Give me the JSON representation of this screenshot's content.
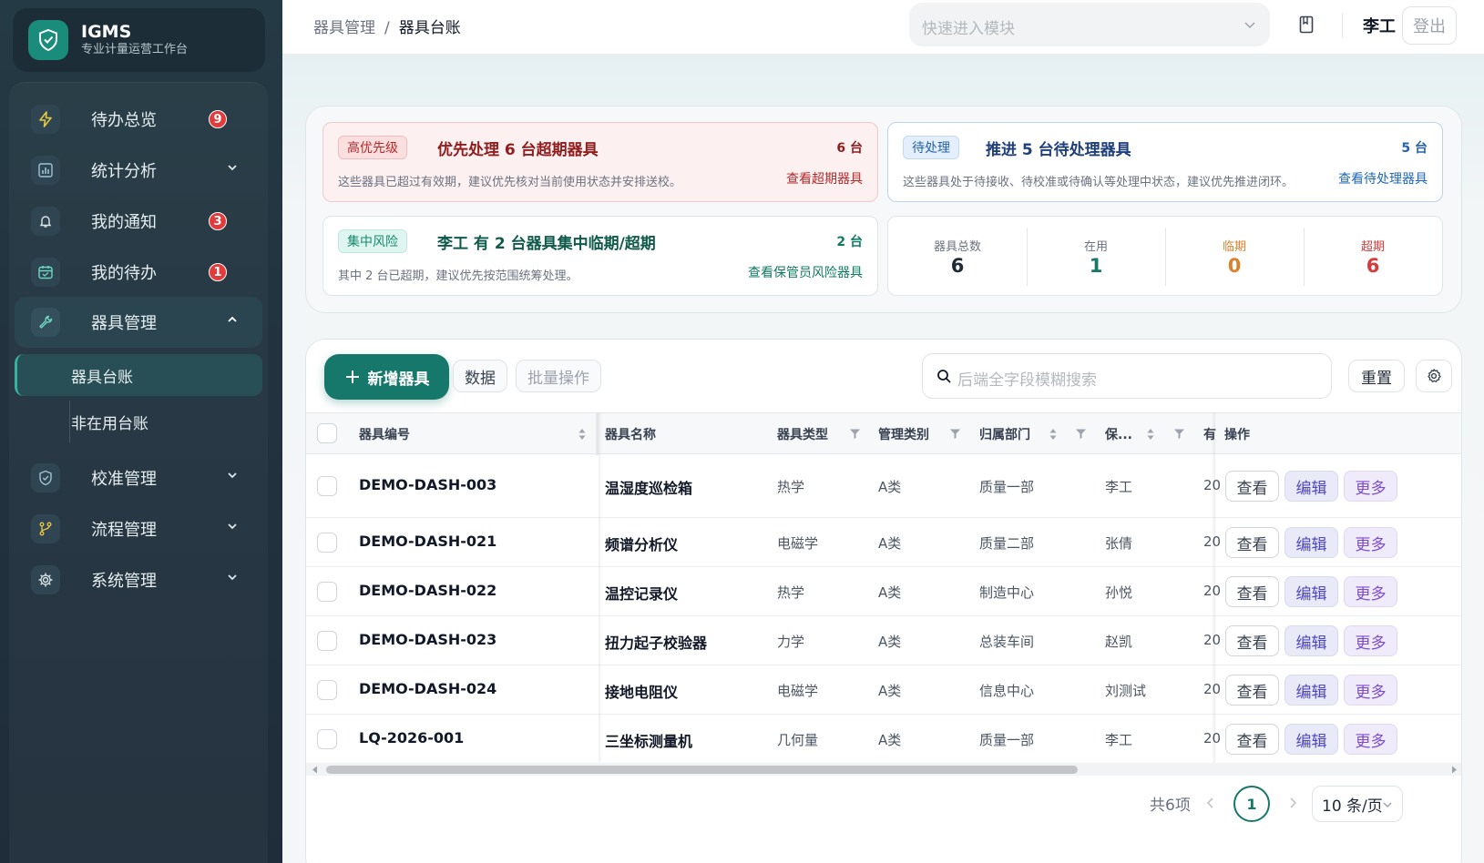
{
  "brand": {
    "name": "IGMS",
    "subtitle": "专业计量运营工作台"
  },
  "sidebar": {
    "items": [
      {
        "label": "待办总览",
        "badge": "9"
      },
      {
        "label": "统计分析"
      },
      {
        "label": "我的通知",
        "badge": "3"
      },
      {
        "label": "我的待办",
        "badge": "1"
      },
      {
        "label": "器具管理"
      },
      {
        "label": "校准管理"
      },
      {
        "label": "流程管理"
      },
      {
        "label": "系统管理"
      }
    ],
    "sub_items": [
      {
        "label": "器具台账"
      },
      {
        "label": "非在用台账"
      }
    ]
  },
  "header": {
    "breadcrumb": [
      "器具管理",
      "器具台账"
    ],
    "quick_placeholder": "快速进入模块",
    "user": "李工",
    "logout": "登出"
  },
  "alerts": {
    "red": {
      "tag": "高优先级",
      "title": "优先处理 6 台超期器具",
      "count": "6 台",
      "desc": "这些器具已超过有效期，建议优先核对当前使用状态并安排送校。",
      "link": "查看超期器具"
    },
    "blue": {
      "tag": "待处理",
      "title": "推进 5 台待处理器具",
      "count": "5 台",
      "desc": "这些器具处于待接收、待校准或待确认等处理中状态，建议优先推进闭环。",
      "link": "查看待处理器具"
    },
    "teal": {
      "tag": "集中风险",
      "title": "李工 有 2 台器具集中临期/超期",
      "count": "2 台",
      "desc": "其中 2 台已超期，建议优先按范围统筹处理。",
      "link": "查看保管员风险器具"
    }
  },
  "stats": [
    {
      "label": "器具总数",
      "value": "6",
      "color": "#1f2937"
    },
    {
      "label": "在用",
      "value": "1",
      "color": "#16786b"
    },
    {
      "label": "临期",
      "value": "0",
      "color": "#d9822b"
    },
    {
      "label": "超期",
      "value": "6",
      "color": "#d93a3a"
    }
  ],
  "toolbar": {
    "new": "新增器具",
    "data": "数据",
    "batch": "批量操作",
    "search_placeholder": "后端全字段模糊搜索",
    "reset": "重置"
  },
  "table": {
    "headers": [
      "器具编号",
      "器具名称",
      "器具类型",
      "管理类别",
      "归属部门",
      "保...",
      "有",
      "操作"
    ],
    "rows": [
      {
        "code": "DEMO-DASH-003",
        "name": "温湿度巡检箱",
        "type": "热学",
        "category": "A类",
        "dept": "质量一部",
        "keeper": "李工",
        "valid": "20"
      },
      {
        "code": "DEMO-DASH-021",
        "name": "频谱分析仪",
        "type": "电磁学",
        "category": "A类",
        "dept": "质量二部",
        "keeper": "张倩",
        "valid": "20"
      },
      {
        "code": "DEMO-DASH-022",
        "name": "温控记录仪",
        "type": "热学",
        "category": "A类",
        "dept": "制造中心",
        "keeper": "孙悦",
        "valid": "20"
      },
      {
        "code": "DEMO-DASH-023",
        "name": "扭力起子校验器",
        "type": "力学",
        "category": "A类",
        "dept": "总装车间",
        "keeper": "赵凯",
        "valid": "20"
      },
      {
        "code": "DEMO-DASH-024",
        "name": "接地电阻仪",
        "type": "电磁学",
        "category": "A类",
        "dept": "信息中心",
        "keeper": "刘测试",
        "valid": "20"
      },
      {
        "code": "LQ-2026-001",
        "name": "三坐标测量机",
        "type": "几何量",
        "category": "A类",
        "dept": "质量一部",
        "keeper": "李工",
        "valid": "20"
      }
    ],
    "actions": {
      "view": "查看",
      "edit": "编辑",
      "more": "更多"
    }
  },
  "pager": {
    "total": "共6项",
    "current": "1",
    "size": "10 条/页"
  }
}
